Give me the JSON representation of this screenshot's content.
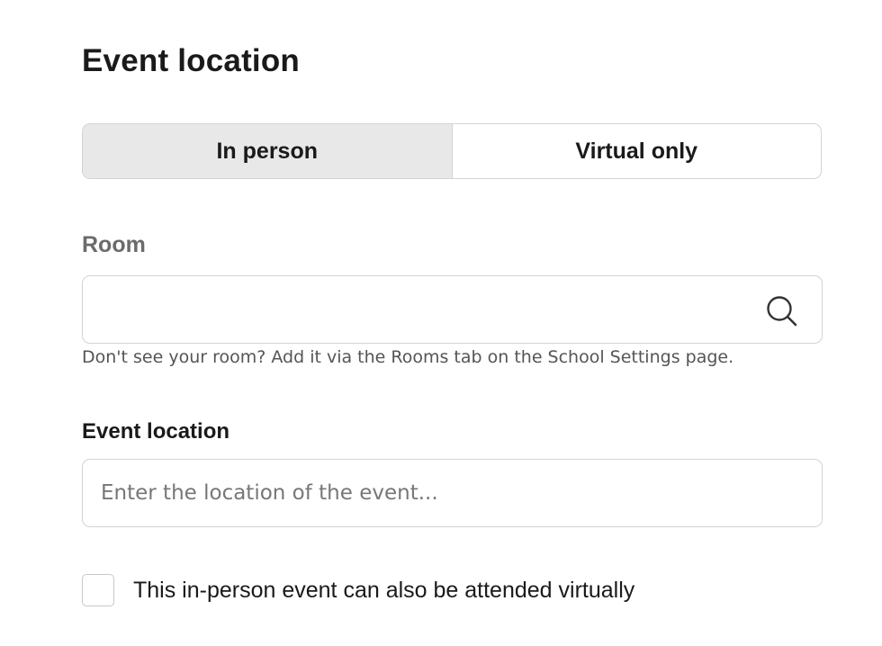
{
  "section": {
    "title": "Event location"
  },
  "location_type": {
    "options": [
      {
        "label": "In person",
        "selected": true
      },
      {
        "label": "Virtual only",
        "selected": false
      }
    ]
  },
  "room": {
    "label": "Room",
    "value": "",
    "help_text": "Don't see your room? Add it via the Rooms tab on the School Settings page.",
    "icon": "search-icon"
  },
  "event_location": {
    "label": "Event location",
    "value": "",
    "placeholder": "Enter the location of the event..."
  },
  "virtual_attendance": {
    "label": "This in-person event can also be attended virtually",
    "checked": false
  },
  "colors": {
    "selected_toggle_bg": "#e8e8e8",
    "border": "#d3d3d3",
    "muted_text": "#6b6b6b"
  }
}
